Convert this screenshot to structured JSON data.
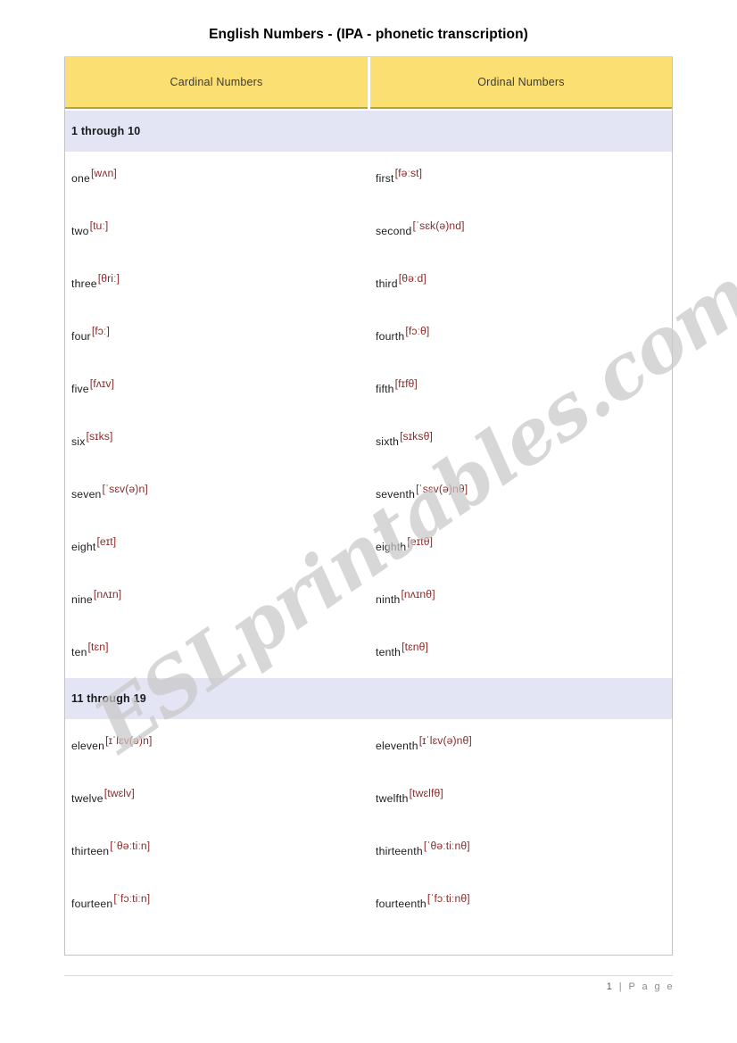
{
  "document": {
    "title": "English Numbers - (IPA - phonetic transcription)",
    "watermark": "ESLprintables.com"
  },
  "table": {
    "headers": {
      "cardinal": "Cardinal Numbers",
      "ordinal": "Ordinal Numbers"
    },
    "sections": [
      {
        "label": "1 through 10",
        "rows": [
          {
            "cardinal_word": "one",
            "cardinal_ipa": "[wʌn]",
            "ordinal_word": "first",
            "ordinal_ipa": "[fəːst]"
          },
          {
            "cardinal_word": "two",
            "cardinal_ipa": "[tuː]",
            "ordinal_word": "second",
            "ordinal_ipa": "[ˈsɛk(ə)nd]"
          },
          {
            "cardinal_word": "three",
            "cardinal_ipa": "[θriː]",
            "ordinal_word": "third",
            "ordinal_ipa": "[θəːd]"
          },
          {
            "cardinal_word": "four",
            "cardinal_ipa": "[fɔː]",
            "ordinal_word": "fourth",
            "ordinal_ipa": "[fɔːθ]"
          },
          {
            "cardinal_word": "five",
            "cardinal_ipa": "[fʌɪv]",
            "ordinal_word": "fifth",
            "ordinal_ipa": "[fɪfθ]"
          },
          {
            "cardinal_word": "six",
            "cardinal_ipa": "[sɪks]",
            "ordinal_word": "sixth",
            "ordinal_ipa": "[sɪksθ]"
          },
          {
            "cardinal_word": "seven",
            "cardinal_ipa": "[ˈsɛv(ə)n]",
            "ordinal_word": "seventh",
            "ordinal_ipa": "[ˈsɛv(ə)nθ]"
          },
          {
            "cardinal_word": "eight",
            "cardinal_ipa": "[eɪt]",
            "ordinal_word": "eighth",
            "ordinal_ipa": "[eɪtθ]"
          },
          {
            "cardinal_word": "nine",
            "cardinal_ipa": "[nʌɪn]",
            "ordinal_word": "ninth",
            "ordinal_ipa": "[nʌɪnθ]"
          },
          {
            "cardinal_word": "ten",
            "cardinal_ipa": "[tɛn]",
            "ordinal_word": "tenth",
            "ordinal_ipa": "[tɛnθ]"
          }
        ]
      },
      {
        "label": "11 through 19",
        "rows": [
          {
            "cardinal_word": "eleven",
            "cardinal_ipa": "[ɪˈlɛv(ə)n]",
            "ordinal_word": "eleventh",
            "ordinal_ipa": "[ɪˈlɛv(ə)nθ]"
          },
          {
            "cardinal_word": "twelve",
            "cardinal_ipa": "[twɛlv]",
            "ordinal_word": "twelfth",
            "ordinal_ipa": "[twɛlfθ]"
          },
          {
            "cardinal_word": "thirteen",
            "cardinal_ipa": "[ˈθəːtiːn]",
            "ordinal_word": "thirteenth",
            "ordinal_ipa": "[ˈθəːtiːnθ]"
          },
          {
            "cardinal_word": "fourteen",
            "cardinal_ipa": "[ˈfɔːtiːn]",
            "ordinal_word": "fourteenth",
            "ordinal_ipa": "[ˈfɔːtiːnθ]"
          }
        ]
      }
    ]
  },
  "footer": {
    "page_number": "1",
    "separator": "|",
    "page_label": "P a g e"
  },
  "colors": {
    "header_yellow": "#fbdf72",
    "header_yellow_border": "#b8a62b",
    "section_lavender": "#e3e4f4",
    "ipa_maroon": "#8d2a2a",
    "table_border": "#c3c3c3"
  }
}
